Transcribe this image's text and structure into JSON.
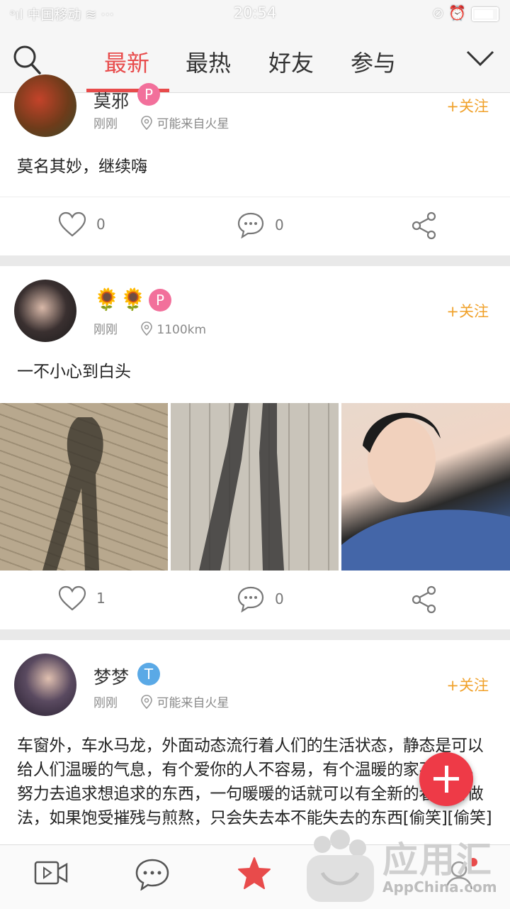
{
  "status_bar": {
    "carrier": "中国移动",
    "time": "20:54"
  },
  "nav": {
    "tabs": [
      "最新",
      "最热",
      "好友",
      "参与"
    ],
    "active_tab": "最新"
  },
  "posts": [
    {
      "name": "莫邪",
      "badge": "P",
      "time": "刚刚",
      "location": "可能来自火星",
      "follow": "+关注",
      "text": "莫名其妙，继续嗨",
      "likes": "0",
      "comments": "0"
    },
    {
      "name": "",
      "badge": "P",
      "time": "刚刚",
      "location": "1100km",
      "follow": "+关注",
      "text": "一不小心到白头",
      "likes": "1",
      "comments": "0"
    },
    {
      "name": "梦梦",
      "badge": "T",
      "time": "刚刚",
      "location": "可能来自火星",
      "follow": "+关注",
      "text": "车窗外，车水马龙，外面动态流行着人们的生活状态，静态是可以给人们温暖的气息，有个爱你的人不容易，有个温暖的家不容易，努力去追求想追求的东西，一句暖暖的话就可以有全新的看法与做法，如果饱受摧残与煎熬，只会失去本不能失去的东西[偷笑][偷笑]"
    }
  ],
  "colors": {
    "accent": "#e84b4b",
    "follow": "#f0a12a",
    "badge_p": "#f2709b",
    "badge_t": "#5aa9e6"
  },
  "watermark": {
    "brand": "应用汇",
    "site": "AppChina.com"
  }
}
